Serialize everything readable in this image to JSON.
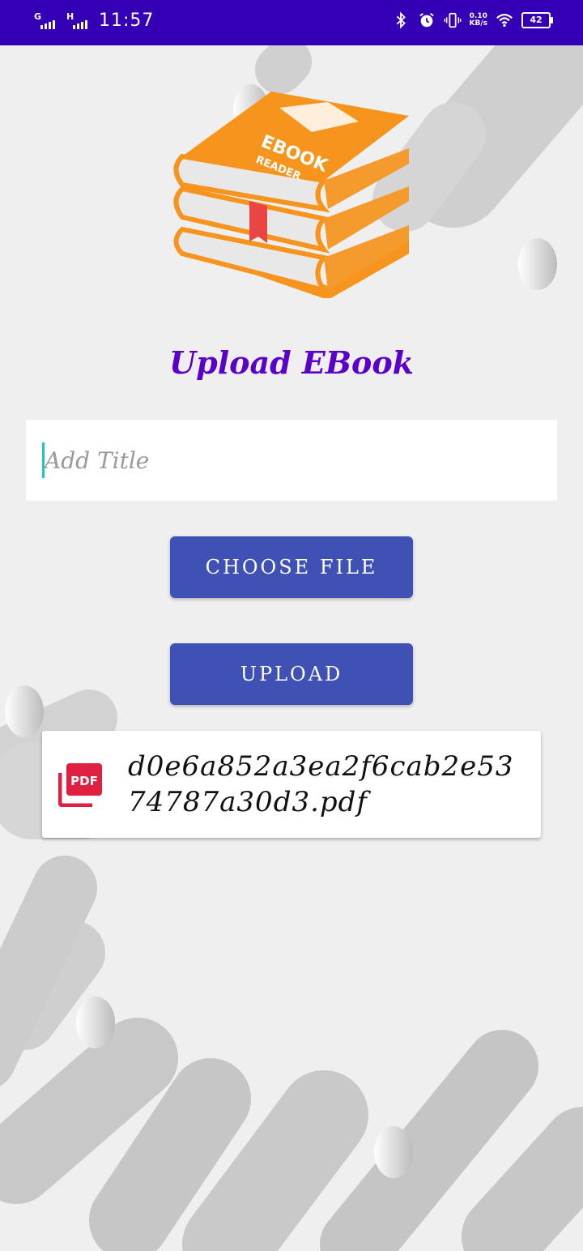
{
  "status_bar": {
    "time": "11:57",
    "network_1": "G",
    "network_2": "H",
    "speed_value": "0.10",
    "speed_unit": "KB/s",
    "battery": "42",
    "icons": [
      "bluetooth-icon",
      "alarm-icon",
      "vibrate-icon",
      "wifi-icon",
      "battery-icon"
    ]
  },
  "logo": {
    "line1": "EBOOK",
    "line2": "READER"
  },
  "page": {
    "title": "Upload EBook"
  },
  "title_input": {
    "value": "",
    "placeholder": "Add Title"
  },
  "buttons": {
    "choose_file": "CHOOSE FILE",
    "upload": "UPLOAD"
  },
  "selected_file": {
    "icon": "pdf-icon",
    "icon_label": "PDF",
    "name": "d0e6a852a3ea2f6cab2e5374787a30d3.pdf"
  },
  "colors": {
    "status_bar": "#3500b5",
    "title": "#5a00c8",
    "button": "#3f51b5",
    "accent_cursor": "#1ec8b4",
    "pdf_red": "#e02040",
    "book_orange": "#f7941d"
  }
}
